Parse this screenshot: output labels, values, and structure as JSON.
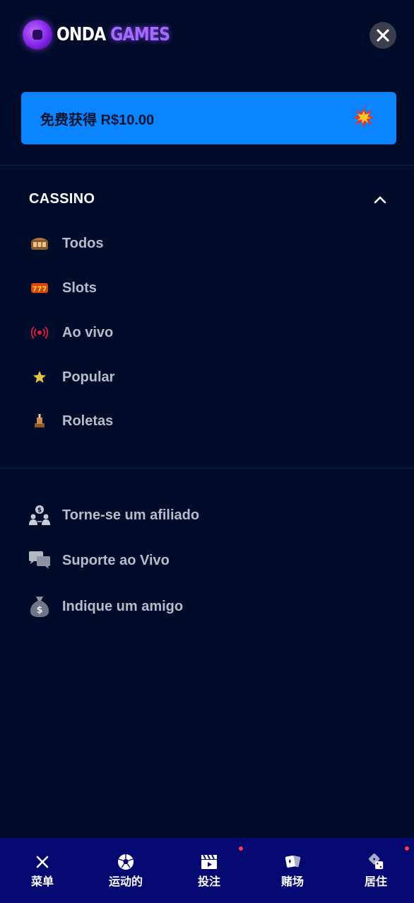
{
  "brand": {
    "name_part1": "ONDA",
    "name_part2": "GAMES"
  },
  "promo": {
    "label": "免费获得 R$10.00",
    "icon": "explosion-icon"
  },
  "casino": {
    "title": "CASSINO",
    "items": [
      {
        "label": "Todos",
        "icon": "slot-machine-icon"
      },
      {
        "label": "Slots",
        "icon": "777-slots-icon"
      },
      {
        "label": "Ao vivo",
        "icon": "live-broadcast-icon"
      },
      {
        "label": "Popular",
        "icon": "star-icon"
      },
      {
        "label": "Roletas",
        "icon": "roulette-icon"
      }
    ]
  },
  "extras": {
    "items": [
      {
        "label": "Torne-se um afiliado",
        "icon": "affiliate-icon"
      },
      {
        "label": "Suporte ao Vivo",
        "icon": "chat-icon"
      },
      {
        "label": "Indique um amigo",
        "icon": "money-bag-icon"
      }
    ]
  },
  "bottom_nav": [
    {
      "label": "菜单",
      "icon": "close-icon"
    },
    {
      "label": "运动的",
      "icon": "soccer-ball-icon"
    },
    {
      "label": "投注",
      "icon": "clapper-icon"
    },
    {
      "label": "赌场",
      "icon": "cards-icon"
    },
    {
      "label": "居住",
      "icon": "dice-icon"
    }
  ],
  "colors": {
    "background": "#010b2a",
    "promo": "#0a84ff",
    "nav": "#050870",
    "menu_text": "#b8bcc8",
    "notification": "#ff3b4a"
  }
}
